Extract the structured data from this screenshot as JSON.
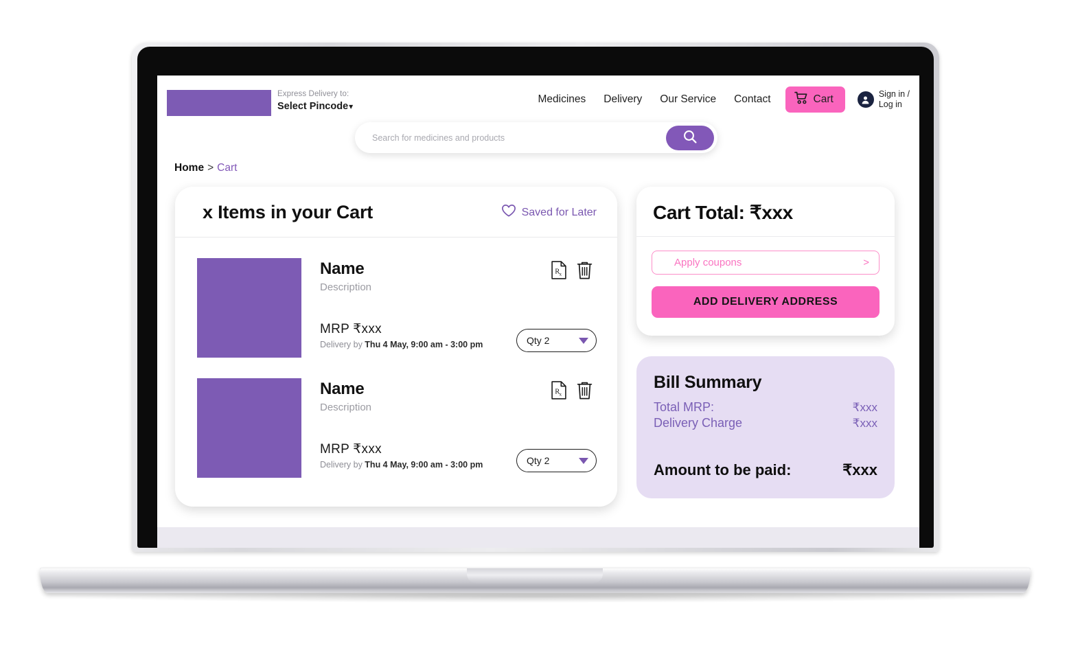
{
  "header": {
    "logo_alt": "brand-logo-placeholder",
    "express_delivery_label": "Express Delivery to:",
    "pincode_value": "Select Pincode",
    "pincode_chevron": "⌄",
    "nav_links": [
      {
        "label": "Medicines"
      },
      {
        "label": "Delivery"
      },
      {
        "label": "Our Service"
      },
      {
        "label": "Contact"
      }
    ],
    "cart_button_label": "Cart",
    "signin_line1": "Sign in /",
    "signin_line2": "Log in"
  },
  "search": {
    "placeholder": "Search for medicines and products",
    "value": ""
  },
  "breadcrumb": {
    "home": "Home",
    "separator": ">",
    "current": "Cart"
  },
  "cart": {
    "title": "x Items in your Cart",
    "saved_for_later_label": "Saved for Later",
    "items": [
      {
        "name": "Name",
        "description": "Description",
        "mrp_label": "MRP",
        "mrp_value": "₹xxx",
        "delivery_prefix": "Delivery by ",
        "delivery_value": "Thu 4 May, 9:00 am - 3:00 pm",
        "qty_label": "Qty 2",
        "rx_icon_text": "Rx"
      },
      {
        "name": "Name",
        "description": "Description",
        "mrp_label": "MRP",
        "mrp_value": "₹xxx",
        "delivery_prefix": "Delivery by ",
        "delivery_value": "Thu 4 May, 9:00 am - 3:00 pm",
        "qty_label": "Qty 2",
        "rx_icon_text": "Rx"
      }
    ]
  },
  "summary": {
    "cart_total_title": "Cart Total: ₹xxx",
    "coupon_placeholder": "Apply coupons",
    "coupon_chevron": ">",
    "add_address_label": "ADD DELIVERY ADDRESS"
  },
  "bill": {
    "title": "Bill Summary",
    "rows": [
      {
        "label": "Total MRP:",
        "amount": "₹xxx"
      },
      {
        "label": "Delivery Charge",
        "amount": "₹xxx"
      }
    ],
    "total_label": "Amount to be paid:",
    "total_amount": "₹xxx"
  },
  "colors": {
    "brand_purple": "#7d5bb4",
    "accent_pink": "#fa64bd",
    "coupon_pink": "#fa74c1",
    "bill_card_bg": "#e6ddf3",
    "link_purple": "#7a57b0",
    "avatar_navy": "#1a2340"
  }
}
